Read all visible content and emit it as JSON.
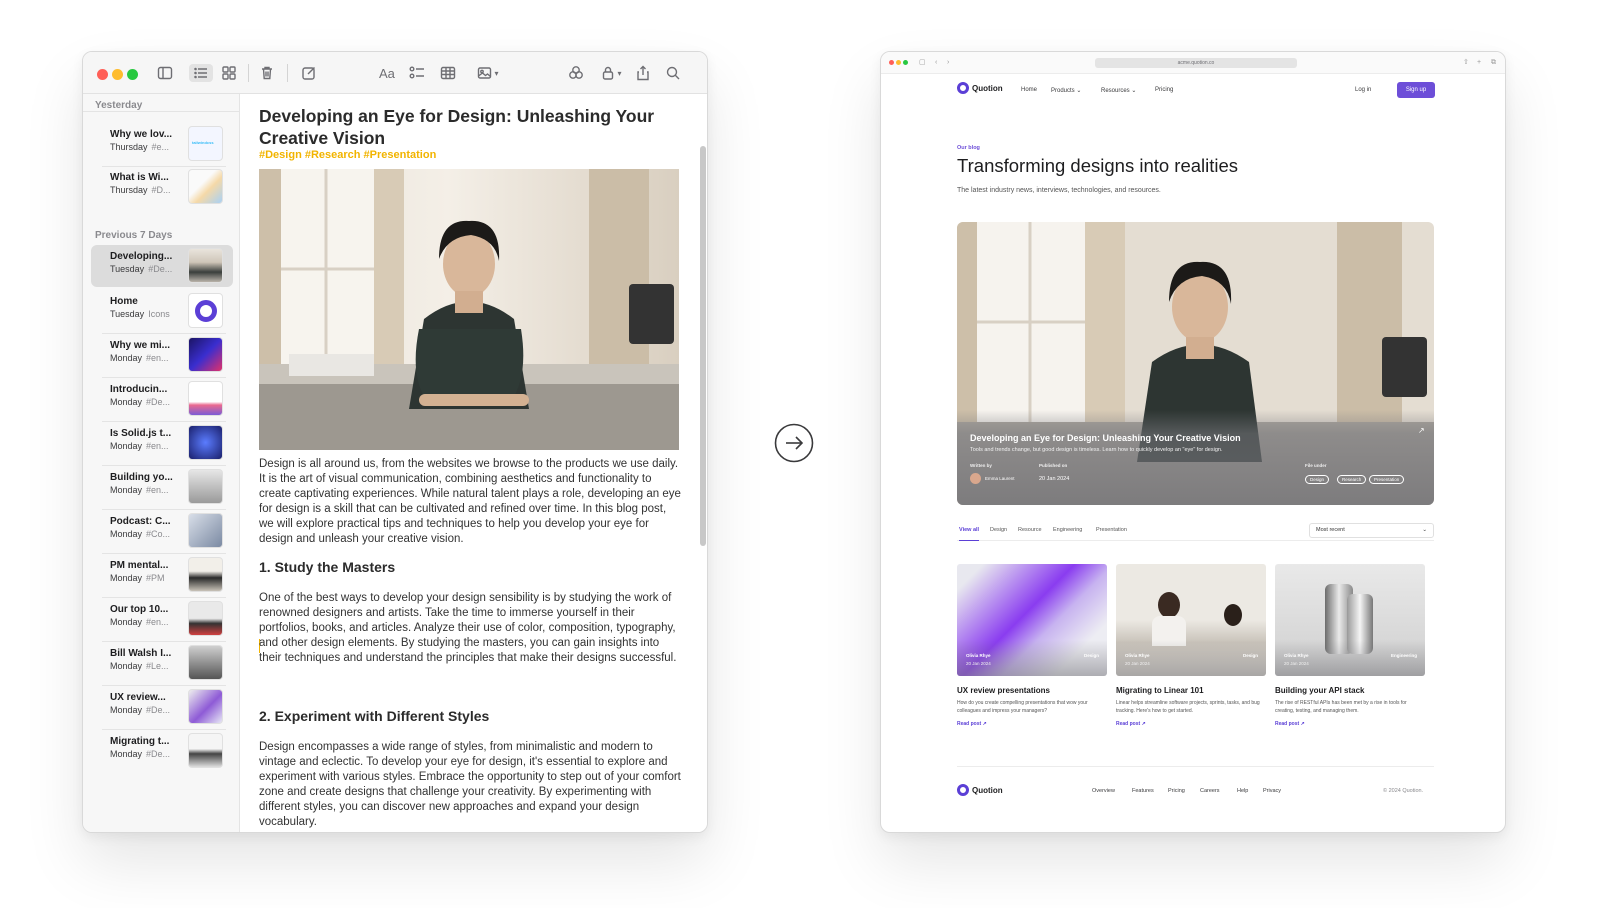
{
  "notes_app": {
    "sections": {
      "yesterday": "Yesterday",
      "previous": "Previous 7 Days"
    },
    "items": [
      {
        "title": "Why we lov...",
        "day": "Thursday",
        "tag": "#e..."
      },
      {
        "title": "What is Wi...",
        "day": "Thursday",
        "tag": "#D..."
      },
      {
        "title": "Developing...",
        "day": "Tuesday",
        "tag": "#De..."
      },
      {
        "title": "Home",
        "day": "Tuesday",
        "tag": "Icons"
      },
      {
        "title": "Why we mi...",
        "day": "Monday",
        "tag": "#en..."
      },
      {
        "title": "Introducin...",
        "day": "Monday",
        "tag": "#De..."
      },
      {
        "title": "Is Solid.js t...",
        "day": "Monday",
        "tag": "#en..."
      },
      {
        "title": "Building yo...",
        "day": "Monday",
        "tag": "#en..."
      },
      {
        "title": "Podcast: C...",
        "day": "Monday",
        "tag": "#Co..."
      },
      {
        "title": "PM mental...",
        "day": "Monday",
        "tag": "#PM"
      },
      {
        "title": "Our top 10...",
        "day": "Monday",
        "tag": "#en..."
      },
      {
        "title": "Bill Walsh I...",
        "day": "Monday",
        "tag": "#Le..."
      },
      {
        "title": "UX review...",
        "day": "Monday",
        "tag": "#De..."
      },
      {
        "title": "Migrating t...",
        "day": "Monday",
        "tag": "#De..."
      }
    ],
    "thumb_logo_text": "tailwindcss",
    "note": {
      "title": "Developing an Eye for Design: Unleashing Your Creative Vision",
      "tags": "#Design #Research #Presentation",
      "intro": "Design is all around us, from the websites we browse to the products we use daily. It is the art of visual communication, combining aesthetics and functionality to create captivating experiences. While natural talent plays a role, developing an eye for design is a skill that can be cultivated and refined over time. In this blog post, we will explore practical tips and techniques to help you develop your eye for design and unleash your creative vision.",
      "h1": "1. Study the Masters",
      "p1": "One of the best ways to develop your design sensibility is by studying the work of renowned designers and artists. Take the time to immerse yourself in their portfolios, books, and articles. Analyze their use of color, composition, typography, and other design elements. By studying the masters, you can gain insights into their techniques and understand the principles that make their designs successful.",
      "h2": "2. Experiment with Different Styles",
      "p2": "Design encompasses a wide range of styles, from minimalistic and modern to vintage and eclectic. To develop your eye for design, it's essential to explore and experiment with various styles. Embrace the opportunity to step out of your comfort zone and create designs that challenge your creativity. By experimenting with different styles, you can discover new approaches and expand your design vocabulary."
    },
    "toolbar_icons": [
      "sidebar-icon",
      "list-view-icon",
      "gallery-view-icon",
      "trash-icon",
      "compose-icon",
      "format-icon",
      "checklist-icon",
      "table-icon",
      "media-icon",
      "collaborate-icon",
      "lock-icon",
      "share-icon",
      "search-icon"
    ],
    "toolbar_format_label": "Aa"
  },
  "website": {
    "url": "acme.quotion.co",
    "brand": "Quotion",
    "nav": [
      "Home",
      "Products",
      "Resources",
      "Pricing"
    ],
    "login": "Log in",
    "signup": "Sign up",
    "eyebrow": "Our blog",
    "title": "Transforming designs into realities",
    "subtitle": "The latest industry news, interviews, technologies, and resources.",
    "hero": {
      "title": "Developing an Eye for Design: Unleashing Your Creative Vision",
      "desc": "Tools and trends change, but good design is timeless. Learn how to quickly develop an \"eye\" for design.",
      "written_by_label": "Written by",
      "author": "Emma Laurent",
      "published_label": "Published on",
      "date": "20 Jan 2024",
      "file_under_label": "File under",
      "chips": [
        "Design",
        "Research",
        "Presentation"
      ]
    },
    "tabs": [
      "View all",
      "Design",
      "Resource",
      "Engineering",
      "Presentation"
    ],
    "sort": "Most recent",
    "cards": [
      {
        "author": "Olivia Rhye",
        "date": "20 Jan 2024",
        "category": "Design",
        "title": "UX review presentations",
        "desc": "How do you create compelling presentations that wow your colleagues and impress your managers?",
        "link": "Read post"
      },
      {
        "author": "Olivia Rhye",
        "date": "20 Jan 2024",
        "category": "Design",
        "title": "Migrating to Linear 101",
        "desc": "Linear helps streamline software projects, sprints, tasks, and bug tracking. Here's how to get started.",
        "link": "Read post"
      },
      {
        "author": "Olivia Rhye",
        "date": "20 Jan 2024",
        "category": "Engineering",
        "title": "Building your API stack",
        "desc": "The rise of RESTful APIs has been met by a rise in tools for creating, testing, and managing them.",
        "link": "Read post"
      }
    ],
    "footer_links": [
      "Overview",
      "Features",
      "Pricing",
      "Careers",
      "Help",
      "Privacy"
    ],
    "copyright": "© 2024 Quotion."
  },
  "colors": {
    "accent": "#6d4ed8",
    "note_tag": "#f2b400"
  }
}
